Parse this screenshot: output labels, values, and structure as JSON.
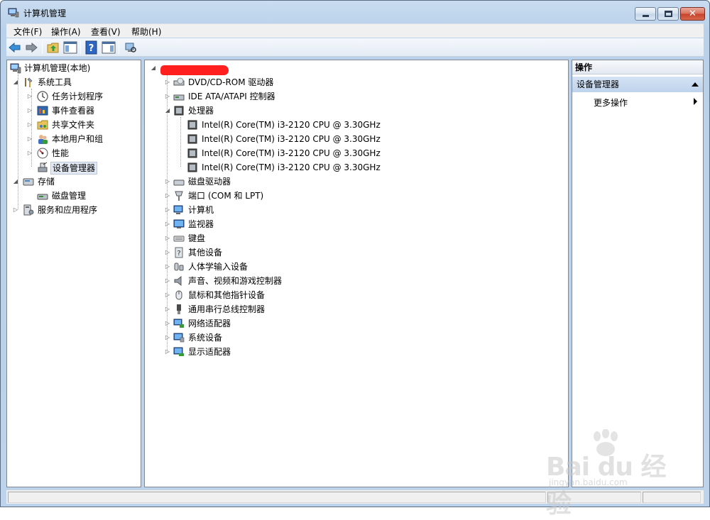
{
  "window": {
    "title": "计算机管理",
    "close_glyph": "✕"
  },
  "menu": [
    "文件(F)",
    "操作(A)",
    "查看(V)",
    "帮助(H)"
  ],
  "toolbar_icons": [
    "back-arrow-icon",
    "forward-arrow-icon",
    "up-folder-icon",
    "show-hide-console-tree-icon",
    "help-icon",
    "show-hide-action-pane-icon",
    "device-properties-icon"
  ],
  "left_tree": {
    "root": "计算机管理(本地)",
    "items": [
      {
        "label": "系统工具",
        "icon": "tools-icon"
      },
      {
        "label": "任务计划程序",
        "icon": "clock-icon"
      },
      {
        "label": "事件查看器",
        "icon": "event-viewer-icon"
      },
      {
        "label": "共享文件夹",
        "icon": "shared-folder-icon"
      },
      {
        "label": "本地用户和组",
        "icon": "users-icon"
      },
      {
        "label": "性能",
        "icon": "performance-icon"
      },
      {
        "label": "设备管理器",
        "icon": "device-manager-icon"
      },
      {
        "label": "存储",
        "icon": "storage-icon"
      },
      {
        "label": "磁盘管理",
        "icon": "disk-management-icon"
      },
      {
        "label": "服务和应用程序",
        "icon": "services-icon"
      }
    ]
  },
  "device_tree": {
    "categories": [
      {
        "label": "DVD/CD-ROM 驱动器",
        "icon": "dvd-drive-icon"
      },
      {
        "label": "IDE ATA/ATAPI 控制器",
        "icon": "ide-controller-icon"
      },
      {
        "label": "处理器",
        "icon": "processor-icon"
      },
      {
        "label": "磁盘驱动器",
        "icon": "disk-drive-icon"
      },
      {
        "label": "端口 (COM 和 LPT)",
        "icon": "port-icon"
      },
      {
        "label": "计算机",
        "icon": "computer-icon"
      },
      {
        "label": "监视器",
        "icon": "monitor-icon"
      },
      {
        "label": "键盘",
        "icon": "keyboard-icon"
      },
      {
        "label": "其他设备",
        "icon": "unknown-device-icon"
      },
      {
        "label": "人体学输入设备",
        "icon": "hid-icon"
      },
      {
        "label": "声音、视频和游戏控制器",
        "icon": "speaker-icon"
      },
      {
        "label": "鼠标和其他指针设备",
        "icon": "mouse-icon"
      },
      {
        "label": "通用串行总线控制器",
        "icon": "usb-icon"
      },
      {
        "label": "网络适配器",
        "icon": "network-adapter-icon"
      },
      {
        "label": "系统设备",
        "icon": "system-device-icon"
      },
      {
        "label": "显示适配器",
        "icon": "display-adapter-icon"
      }
    ],
    "processors": [
      "Intel(R) Core(TM) i3-2120 CPU @ 3.30GHz",
      "Intel(R) Core(TM) i3-2120 CPU @ 3.30GHz",
      "Intel(R) Core(TM) i3-2120 CPU @ 3.30GHz",
      "Intel(R) Core(TM) i3-2120 CPU @ 3.30GHz"
    ]
  },
  "actions": {
    "header": "操作",
    "section": "设备管理器",
    "item": "更多操作"
  },
  "watermark": {
    "brand": "Bai du 经验",
    "url": "jingyan.baidu.com"
  },
  "colors": {
    "window_frame": "#b9d1ea",
    "selection": "#e2e9f3",
    "actions_section": "#c9dcf1",
    "redaction": "#ff1f1f"
  }
}
